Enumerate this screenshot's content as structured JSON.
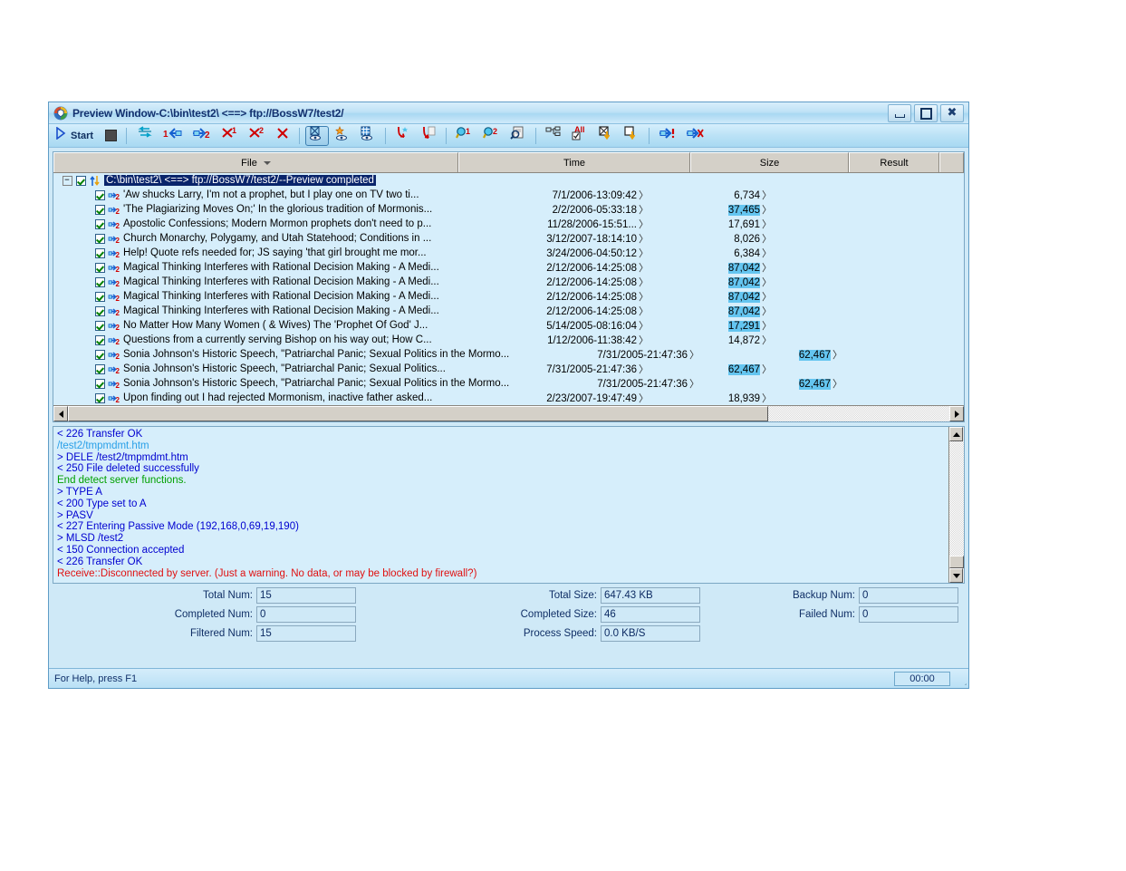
{
  "window": {
    "title": "Preview Window-C:\\bin\\test2\\ <==> ftp://BossW7/test2/",
    "icon": "app-logo-icon",
    "controls": [
      {
        "name": "minimize-button",
        "label": "_"
      },
      {
        "name": "maximize-button",
        "label": "□"
      },
      {
        "name": "close-button",
        "label": "✖"
      }
    ]
  },
  "toolbar": {
    "start_label": "Start",
    "items": [
      {
        "name": "start-button",
        "label": "Start",
        "icon": "play-icon"
      },
      {
        "name": "stop-button",
        "label": "",
        "icon": "stop-icon"
      },
      {
        "name": "sync-both-button",
        "label": "",
        "icon": "sync-both-arrows-icon"
      },
      {
        "name": "sync-to-1-button",
        "label": "1",
        "icon": "arrow-left-1-icon"
      },
      {
        "name": "sync-to-2-button",
        "label": "2",
        "icon": "arrow-right-2-icon"
      },
      {
        "name": "delete-1-button",
        "label": "1",
        "icon": "delete-x-1-icon"
      },
      {
        "name": "delete-2-button",
        "label": "2",
        "icon": "delete-x-2-icon"
      },
      {
        "name": "delete-button",
        "label": "",
        "icon": "delete-x-icon"
      },
      {
        "name": "preview-all-button",
        "label": "",
        "icon": "preview-eye-icon"
      },
      {
        "name": "preview-new-button",
        "label": "",
        "icon": "preview-eye-star-icon"
      },
      {
        "name": "preview-diff-button",
        "label": "",
        "icon": "preview-eye-grid-icon"
      },
      {
        "name": "refresh-new-button",
        "label": "",
        "icon": "red-arrow-star-icon"
      },
      {
        "name": "refresh-file-button",
        "label": "",
        "icon": "red-arrow-file-icon"
      },
      {
        "name": "browse-1-button",
        "label": "1",
        "icon": "magnifier-1-icon"
      },
      {
        "name": "browse-2-button",
        "label": "2",
        "icon": "magnifier-2-icon"
      },
      {
        "name": "inspect-button",
        "label": "",
        "icon": "magnifier-doc-icon"
      },
      {
        "name": "tree-view-button",
        "label": "",
        "icon": "tree-structure-icon"
      },
      {
        "name": "select-all-button",
        "label": "All",
        "icon": "check-all-icon"
      },
      {
        "name": "uncheck-download-button",
        "label": "",
        "icon": "box-x-down-arrow-icon"
      },
      {
        "name": "check-download-button",
        "label": "",
        "icon": "box-down-arrow-icon"
      },
      {
        "name": "transfer-now-button",
        "label": "",
        "icon": "blue-arrow-exclaim-icon"
      },
      {
        "name": "transfer-cancel-button",
        "label": "",
        "icon": "blue-arrow-x-icon"
      }
    ]
  },
  "list": {
    "columns": [
      {
        "name": "column-file",
        "label": "File",
        "sorted": true
      },
      {
        "name": "column-time",
        "label": "Time"
      },
      {
        "name": "column-size",
        "label": "Size"
      },
      {
        "name": "column-result",
        "label": "Result"
      }
    ],
    "root": {
      "label": "C:\\bin\\test2\\ <==> ftp://BossW7/test2/--Preview completed",
      "checked": true,
      "expanded": true
    },
    "rows": [
      {
        "file": "'Aw shucks Larry, I'm not a prophet, but I play one on TV two ti...",
        "time": "7/1/2006-13:09:42",
        "size": "6,734",
        "size_col": 1,
        "highlight": false
      },
      {
        "file": "'The Plagiarizing Moves On;' In the glorious tradition of Mormonis...",
        "time": "2/2/2006-05:33:18",
        "size": "37,465",
        "size_col": 1,
        "highlight": true
      },
      {
        "file": "Apostolic Confessions; Modern Mormon prophets don't need to p...",
        "time": "11/28/2006-15:51...",
        "size": "17,691",
        "size_col": 1,
        "highlight": false
      },
      {
        "file": "Church Monarchy, Polygamy, and Utah Statehood; Conditions in ...",
        "time": "3/12/2007-18:14:10",
        "size": "8,026",
        "size_col": 1,
        "highlight": false
      },
      {
        "file": "Help! Quote refs needed for; JS saying 'that girl brought me mor...",
        "time": "3/24/2006-04:50:12",
        "size": "6,384",
        "size_col": 1,
        "highlight": false
      },
      {
        "file": "Magical Thinking Interferes with Rational Decision Making - A Medi...",
        "time": "2/12/2006-14:25:08",
        "size": "87,042",
        "size_col": 1,
        "highlight": true
      },
      {
        "file": "Magical Thinking Interferes with Rational Decision Making - A Medi...",
        "time": "2/12/2006-14:25:08",
        "size": "87,042",
        "size_col": 1,
        "highlight": true
      },
      {
        "file": "Magical Thinking Interferes with Rational Decision Making - A Medi...",
        "time": "2/12/2006-14:25:08",
        "size": "87,042",
        "size_col": 1,
        "highlight": true
      },
      {
        "file": "Magical Thinking Interferes with Rational Decision Making - A Medi...",
        "time": "2/12/2006-14:25:08",
        "size": "87,042",
        "size_col": 1,
        "highlight": true
      },
      {
        "file": "No Matter How Many Women ( & Wives) The 'Prophet Of God' J...",
        "time": "5/14/2005-08:16:04",
        "size": "17,291",
        "size_col": 1,
        "highlight": true
      },
      {
        "file": "Questions from a currently serving Bishop on his way out; How C...",
        "time": "1/12/2006-11:38:42",
        "size": "14,872",
        "size_col": 1,
        "highlight": false
      },
      {
        "file": "Sonia Johnson's Historic Speech, \"Patriarchal Panic; Sexual Politics in the Mormo...",
        "time": "7/31/2005-21:47:36",
        "size": "62,467",
        "size_col": 2,
        "highlight": true
      },
      {
        "file": "Sonia Johnson's Historic Speech, \"Patriarchal Panic; Sexual Politics...",
        "time": "7/31/2005-21:47:36",
        "size": "62,467",
        "size_col": 1,
        "highlight": true
      },
      {
        "file": "Sonia Johnson's Historic Speech, \"Patriarchal Panic; Sexual Politics in the Mormo...",
        "time": "7/31/2005-21:47:36",
        "size": "62,467",
        "size_col": 2,
        "highlight": true
      },
      {
        "file": "Upon finding out I had rejected Mormonism, inactive father asked...",
        "time": "2/23/2007-19:47:49",
        "size": "18,939",
        "size_col": 1,
        "highlight": false
      }
    ]
  },
  "log": {
    "lines": [
      {
        "text": "< 226 Transfer OK",
        "color": "#0000d0"
      },
      {
        "text": "   /test2/tmpmdmt.htm",
        "color": "#2aa0e8"
      },
      {
        "text": "> DELE /test2/tmpmdmt.htm",
        "color": "#0000d0"
      },
      {
        "text": "< 250 File deleted successfully",
        "color": "#0000d0"
      },
      {
        "text": "   End detect server functions.",
        "color": "#00a000"
      },
      {
        "text": "> TYPE A",
        "color": "#0000d0"
      },
      {
        "text": "< 200 Type set to A",
        "color": "#0000d0"
      },
      {
        "text": "> PASV",
        "color": "#0000d0"
      },
      {
        "text": "< 227 Entering Passive Mode (192,168,0,69,19,190)",
        "color": "#0000d0"
      },
      {
        "text": "> MLSD /test2",
        "color": "#0000d0"
      },
      {
        "text": "< 150 Connection accepted",
        "color": "#0000d0"
      },
      {
        "text": "< 226 Transfer OK",
        "color": "#0000d0"
      },
      {
        "text": "  Receive::Disconnected by server. (Just a warning. No data, or may be blocked by firewall?)",
        "color": "#e01010"
      }
    ]
  },
  "stats": {
    "col1": [
      {
        "name": "total-num",
        "label": "Total Num:",
        "value": "15"
      },
      {
        "name": "completed-num",
        "label": "Completed Num:",
        "value": "0"
      },
      {
        "name": "filtered-num",
        "label": "Filtered Num:",
        "value": "15"
      }
    ],
    "col2": [
      {
        "name": "total-size",
        "label": "Total Size:",
        "value": "647.43 KB"
      },
      {
        "name": "completed-size",
        "label": "Completed Size:",
        "value": "46"
      },
      {
        "name": "process-speed",
        "label": "Process Speed:",
        "value": "0.0 KB/S"
      }
    ],
    "col3": [
      {
        "name": "backup-num",
        "label": "Backup Num:",
        "value": "0"
      },
      {
        "name": "failed-num",
        "label": "Failed Num:",
        "value": "0"
      }
    ]
  },
  "statusbar": {
    "help_text": "For Help, press F1",
    "timer": "00:00"
  },
  "colors": {
    "pane_bg": "#d6eefb",
    "window_bg": "#cfe9f7",
    "highlight": "#64c5f0",
    "selection": "#09246b",
    "header_bg": "#d4d0c8"
  }
}
